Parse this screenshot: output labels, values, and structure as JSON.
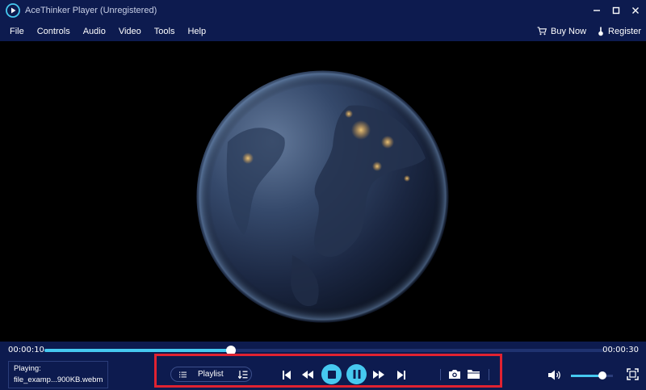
{
  "app": {
    "title": "AceThinker Player (Unregistered)"
  },
  "menu": {
    "items": [
      "File",
      "Controls",
      "Audio",
      "Video",
      "Tools",
      "Help"
    ],
    "buy_now": "Buy Now",
    "register": "Register"
  },
  "player": {
    "current_time": "00:00:10",
    "total_time": "00:00:30",
    "progress": 0.333,
    "volume": 0.75,
    "now_playing_label": "Playing:",
    "now_playing_file": "file_examp...900KB.webm",
    "playlist_label": "Playlist"
  },
  "icons": {
    "logo": "play-logo-icon",
    "minimize": "minimize-icon",
    "maximize": "maximize-icon",
    "close": "close-icon",
    "cart": "cart-icon",
    "register": "key-icon",
    "playlist": "list-icon",
    "sort": "sort-icon",
    "prev": "skip-previous-icon",
    "rewind": "rewind-icon",
    "stop": "stop-icon",
    "pause": "pause-icon",
    "forward": "fast-forward-icon",
    "next": "skip-next-icon",
    "snapshot": "camera-icon",
    "folder": "folder-icon",
    "volume": "volume-icon",
    "fullscreen": "fullscreen-icon"
  },
  "colors": {
    "chrome": "#0d1b4f",
    "accent": "#46c9f0",
    "highlight": "#e02231"
  }
}
